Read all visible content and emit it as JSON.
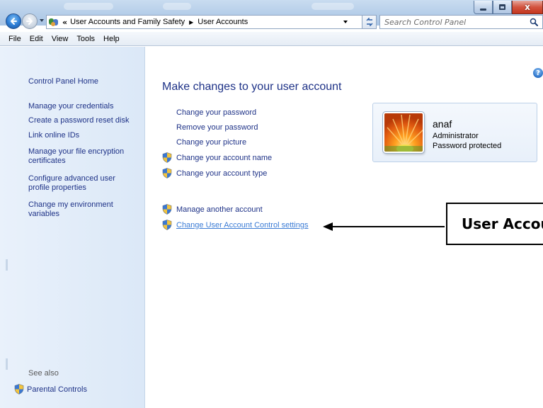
{
  "window": {
    "minimize_icon": "minimize-icon",
    "maximize_icon": "maximize-icon",
    "close_symbol": "x"
  },
  "address_bar": {
    "overflow_symbol": "«",
    "breadcrumbs": [
      "User Accounts and Family Safety",
      "User Accounts"
    ]
  },
  "search": {
    "placeholder": "Search Control Panel"
  },
  "menu": {
    "items": [
      {
        "label": "File"
      },
      {
        "label": "Edit"
      },
      {
        "label": "View"
      },
      {
        "label": "Tools"
      },
      {
        "label": "Help"
      }
    ]
  },
  "left_pane": {
    "links": [
      "Control Panel Home",
      "Manage your credentials",
      "Create a password reset disk",
      "Link online IDs",
      "Manage your file encryption certificates",
      "Configure advanced user profile properties",
      "Change my environment variables"
    ],
    "see_also_label": "See also",
    "see_also_links": [
      "Parental Controls"
    ]
  },
  "main": {
    "title": "Make changes to your user account",
    "tasks": [
      "Change your password",
      "Remove your password",
      "Change your picture"
    ],
    "shield_tasks": [
      "Change your account name",
      "Change your account type"
    ],
    "other_tasks": [
      "Manage another account",
      "Change User Account Control settings"
    ],
    "help_symbol": "?"
  },
  "user": {
    "name": "anaf",
    "role": "Administrator",
    "status": "Password protected"
  },
  "annotation": {
    "callout_text": "User Account Control"
  },
  "colors": {
    "link": "#1e3287",
    "link_hover": "#3a7bd5",
    "left_pane_bg": "#dbe8f7",
    "titlebar": "#b8d0ea",
    "close_button": "#c4361f"
  }
}
